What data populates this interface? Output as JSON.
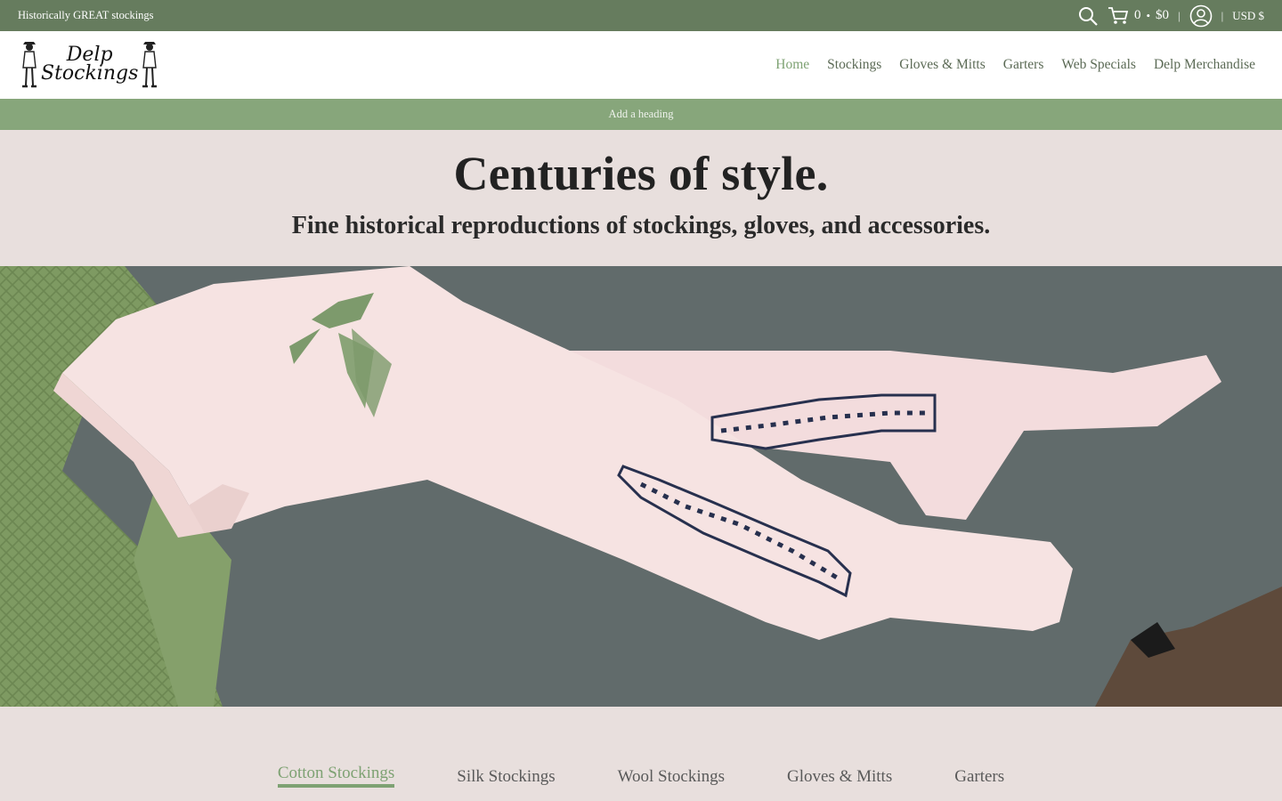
{
  "topbar": {
    "promo": "Historically GREAT stockings",
    "cart_count": "0",
    "cart_dot": "•",
    "cart_total": "$0",
    "currency": "USD $"
  },
  "header": {
    "logo_line1": "Delp",
    "logo_line2": "Stockings",
    "nav": [
      "Home",
      "Stockings",
      "Gloves & Mitts",
      "Garters",
      "Web Specials",
      "Delp Merchandise"
    ]
  },
  "banner": {
    "text": "Add a heading"
  },
  "hero": {
    "title": "Centuries of style.",
    "subtitle": "Fine historical reproductions of stockings, gloves, and accessories."
  },
  "tabs": [
    "Cotton Stockings",
    "Silk Stockings",
    "Wool Stockings",
    "Gloves & Mitts",
    "Garters"
  ],
  "colors": {
    "topbar": "#667c5e",
    "accent": "#7ea273",
    "band": "#87a67b",
    "background": "#e8dfdd"
  }
}
